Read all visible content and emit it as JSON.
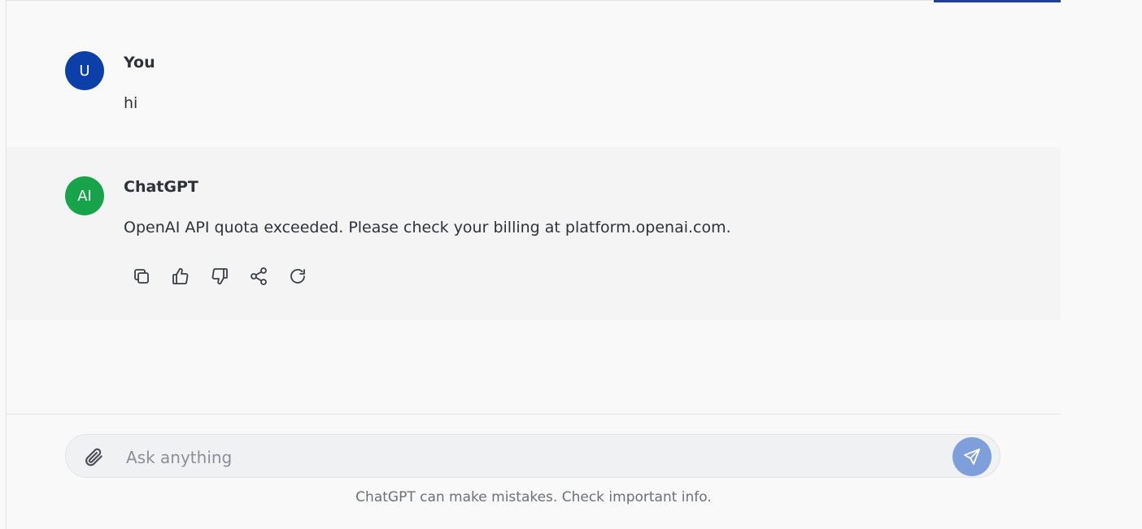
{
  "messages": [
    {
      "role": "user",
      "avatar_text": "U",
      "author": "You",
      "text": "hi",
      "avatar_color": "#0d3fa8"
    },
    {
      "role": "assistant",
      "avatar_text": "AI",
      "author": "ChatGPT",
      "text": "OpenAI API quota exceeded. Please check your billing at platform.openai.com.",
      "avatar_color": "#16a34a",
      "actions": [
        "copy-icon",
        "thumbs-up-icon",
        "thumbs-down-icon",
        "share-icon",
        "regenerate-icon"
      ]
    }
  ],
  "composer": {
    "placeholder": "Ask anything",
    "value": "",
    "attach_icon": "paperclip-icon",
    "send_icon": "send-icon"
  },
  "footer": {
    "disclaimer": "ChatGPT can make mistakes. Check important info."
  },
  "colors": {
    "accent": "#1f3f99",
    "send_button": "#7f9fdc",
    "assistant_bg": "#f4f4f4",
    "page_bg": "#f9f9f9"
  }
}
